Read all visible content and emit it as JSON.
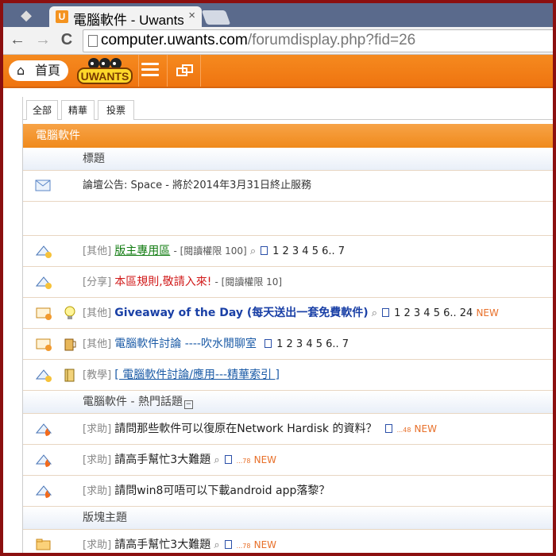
{
  "browser": {
    "tab_title": "電腦軟件 - Uwants",
    "tab_favicon_letter": "U",
    "close_glyph": "×",
    "back_glyph": "←",
    "forward_glyph": "→",
    "reload_glyph": "C",
    "url_host": "computer.uwants.com",
    "url_path": "/forumdisplay.php?fid=26"
  },
  "site": {
    "home_label": "首頁",
    "logo_text": "UWANTS",
    "accent": "#f07d16"
  },
  "filters": [
    "全部",
    "精華",
    "投票"
  ],
  "forum_name": "電腦軟件",
  "sections": {
    "header": "標題",
    "hot": "電腦軟件 - 熱門話題",
    "collapse": "−",
    "board": "版塊主題"
  },
  "announcement": {
    "prefix": "論壇公告:",
    "text": "Space - 將於2014年3月31日終止服務"
  },
  "threads": [
    {
      "tag": "[其他]",
      "title": "版主專用區",
      "extra": "- [閱讀權限 100]",
      "pages": "1  2  3  4  5  6..  7"
    },
    {
      "tag": "[分享]",
      "title": "本區規則,敬請入來!",
      "extra": "- [閱讀權限 10]"
    },
    {
      "tag": "[其他]",
      "title": "Giveaway of the Day (每天送出一套免費軟件)",
      "pages": "1  2  3  4  5  6..  24",
      "new": "NEW"
    },
    {
      "tag": "[其他]",
      "title": "電腦軟件討論 ----吹水閒聊室",
      "pages": "1  2  3  4  5  6..  7"
    },
    {
      "tag": "[教學]",
      "title": "[ 電腦軟件討論/應用---精華索引 ]"
    }
  ],
  "hot_threads": [
    {
      "tag": "[求助]",
      "title": "請問那些軟件可以復原在Network Hardisk 的資料？",
      "mini": "...48",
      "new": "NEW"
    },
    {
      "tag": "[求助]",
      "title": "請高手幫忙3大難題",
      "mini": "...78",
      "new": "NEW"
    },
    {
      "tag": "[求助]",
      "title": "請問win8可唔可以下載android app落黎？"
    }
  ],
  "board_threads": [
    {
      "tag": "[求助]",
      "title": "請高手幫忙3大難題",
      "mini": "...78",
      "new": "NEW"
    }
  ],
  "attachment_glyph": "⌕"
}
